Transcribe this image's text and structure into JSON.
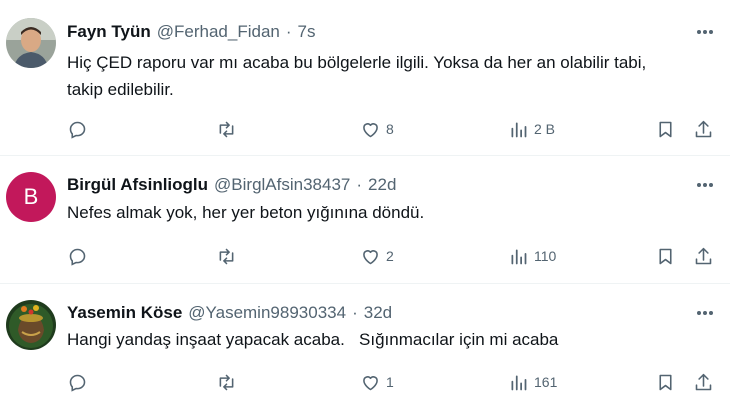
{
  "tweets": [
    {
      "name": "Fayn Tyün",
      "handle": "@Ferhad_Fidan",
      "separator": "·",
      "time": "7s",
      "text_line1": "Hiç ÇED raporu var mı acaba bu bölgelerle ilgili. Yoksa da her an olabilir tabi,",
      "text_line2": "takip edilebilir.",
      "likes": "8",
      "views": "2 B"
    },
    {
      "name": "Birgül Afsinlioglu",
      "handle": "@BirglAfsin38437",
      "separator": "·",
      "time": "22d",
      "avatar_letter": "B",
      "text_line1": "Nefes almak yok, her yer beton yığınına döndü.",
      "likes": "2",
      "views": "110"
    },
    {
      "name": "Yasemin Köse",
      "handle": "@Yasemin98930334",
      "separator": "·",
      "time": "32d",
      "text_line1": "Hangi yandaş inşaat yapacak acaba.   Sığınmacılar için mi acaba",
      "likes": "1",
      "views": "161"
    }
  ],
  "colors": {
    "text": "#0f1419",
    "secondary": "#536471",
    "divider": "#eff3f4",
    "avatar_letter_bg": "#c2185b"
  },
  "icons": [
    "reply-icon",
    "retweet-icon",
    "like-icon",
    "views-icon",
    "bookmark-icon",
    "share-icon",
    "more-icon"
  ]
}
